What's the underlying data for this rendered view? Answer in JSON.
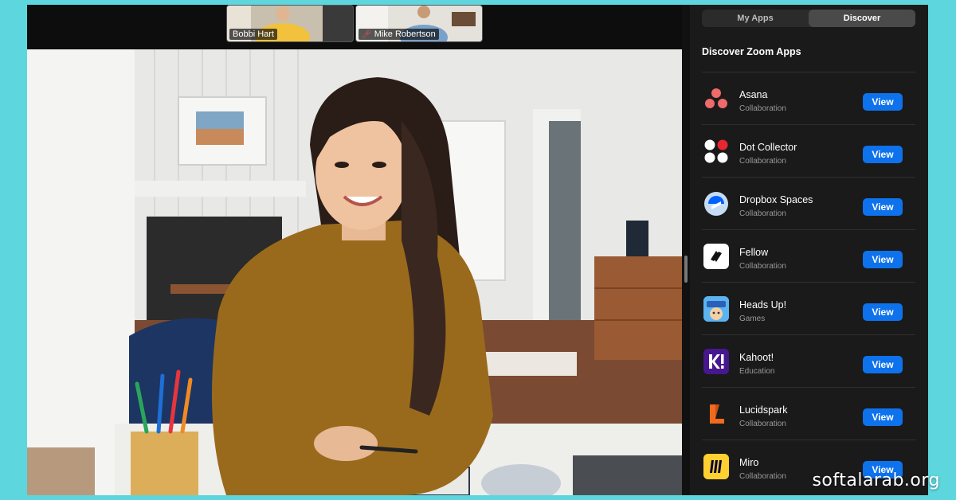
{
  "meeting": {
    "participants": [
      {
        "name": "Bobbi Hart",
        "muted": false
      },
      {
        "name": "Mike Robertson",
        "muted": true
      }
    ]
  },
  "panel": {
    "tabs": [
      {
        "label": "My Apps",
        "active": false
      },
      {
        "label": "Discover",
        "active": true
      }
    ],
    "title": "Discover Zoom Apps",
    "apps": [
      {
        "name": "Asana",
        "category": "Collaboration",
        "icon": "asana-icon",
        "button": "View"
      },
      {
        "name": "Dot Collector",
        "category": "Collaboration",
        "icon": "dot-collector-icon",
        "button": "View"
      },
      {
        "name": "Dropbox Spaces",
        "category": "Collaboration",
        "icon": "dropbox-spaces-icon",
        "button": "View"
      },
      {
        "name": "Fellow",
        "category": "Collaboration",
        "icon": "fellow-icon",
        "button": "View"
      },
      {
        "name": "Heads Up!",
        "category": "Games",
        "icon": "heads-up-icon",
        "button": "View"
      },
      {
        "name": "Kahoot!",
        "category": "Education",
        "icon": "kahoot-icon",
        "button": "View"
      },
      {
        "name": "Lucidspark",
        "category": "Collaboration",
        "icon": "lucidspark-icon",
        "button": "View"
      },
      {
        "name": "Miro",
        "category": "Collaboration",
        "icon": "miro-icon",
        "button": "View"
      }
    ]
  },
  "watermark": "softalarab.org",
  "colors": {
    "background": "#5ed6de",
    "accent": "#0e72ed",
    "panel": "#1a1a1a"
  }
}
